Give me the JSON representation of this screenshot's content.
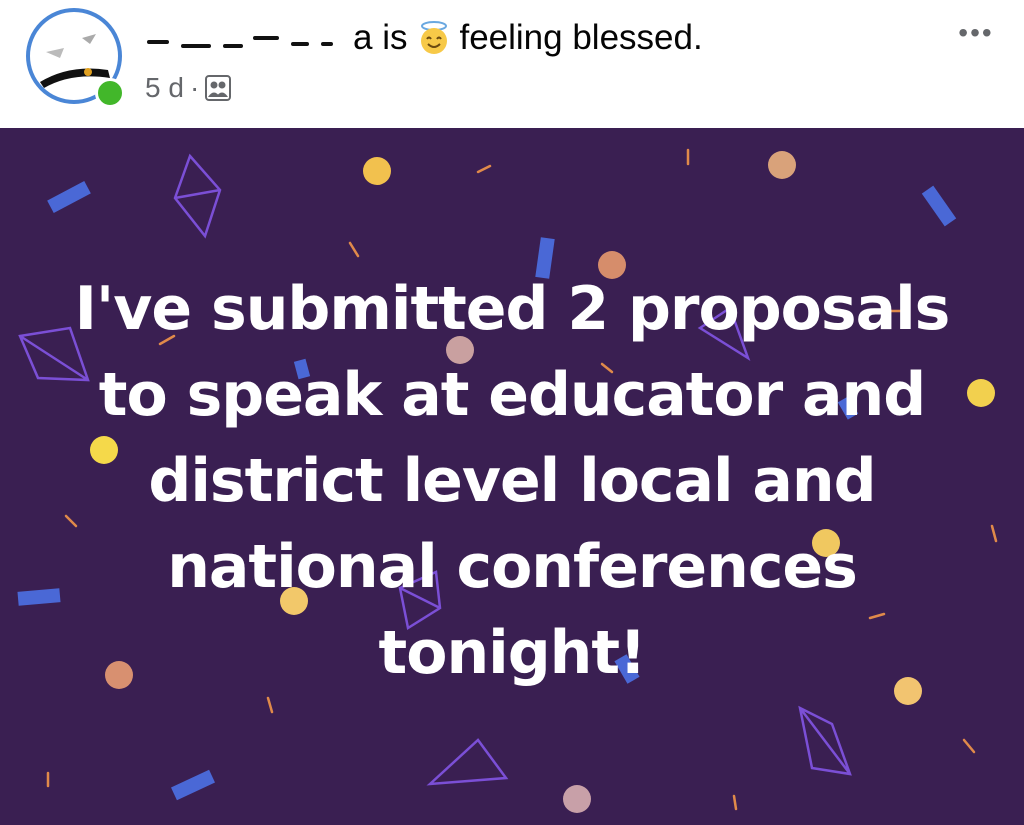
{
  "post": {
    "author_suffix": "a is",
    "feeling_emoji": "smiling-face-with-halo",
    "feeling_text": "feeling blessed.",
    "timestamp": "5 d",
    "separator": "·",
    "audience_icon": "friends-icon",
    "more_label": "•••",
    "body_text": "I've submitted 2 proposals to speak at educator and district level local and national conferences tonight!"
  },
  "colors": {
    "card_background": "#3a1f52",
    "online_indicator": "#42b72a",
    "avatar_ring": "#4a86d6"
  }
}
